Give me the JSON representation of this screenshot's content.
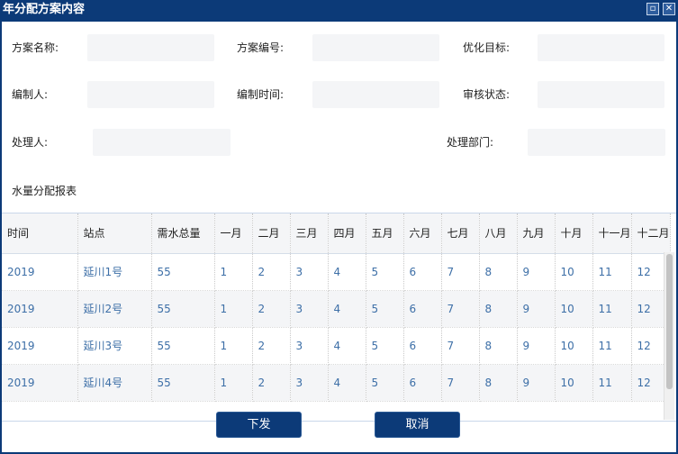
{
  "window": {
    "title": "年分配方案内容",
    "maximize_symbol": "▫",
    "close_symbol": "✕"
  },
  "form": {
    "plan_name": {
      "label": "方案名称:",
      "value": ""
    },
    "plan_code": {
      "label": "方案编号:",
      "value": ""
    },
    "goal": {
      "label": "优化目标:",
      "value": ""
    },
    "author": {
      "label": "编制人:",
      "value": ""
    },
    "compile_time": {
      "label": "编制时间:",
      "value": ""
    },
    "review_status": {
      "label": "审核状态:",
      "value": ""
    },
    "handler": {
      "label": "处理人:",
      "value": ""
    },
    "department": {
      "label": "处理部门:",
      "value": ""
    }
  },
  "section_title": "水量分配报表",
  "table": {
    "headers": [
      "时间",
      "站点",
      "需水总量",
      "一月",
      "二月",
      "三月",
      "四月",
      "五月",
      "六月",
      "七月",
      "八月",
      "九月",
      "十月",
      "十一月",
      "十二月"
    ],
    "rows": [
      [
        "2019",
        "延川1号",
        "55",
        "1",
        "2",
        "3",
        "4",
        "5",
        "6",
        "7",
        "8",
        "9",
        "10",
        "11",
        "12"
      ],
      [
        "2019",
        "延川2号",
        "55",
        "1",
        "2",
        "3",
        "4",
        "5",
        "6",
        "7",
        "8",
        "9",
        "10",
        "11",
        "12"
      ],
      [
        "2019",
        "延川3号",
        "55",
        "1",
        "2",
        "3",
        "4",
        "5",
        "6",
        "7",
        "8",
        "9",
        "10",
        "11",
        "12"
      ],
      [
        "2019",
        "延川4号",
        "55",
        "1",
        "2",
        "3",
        "4",
        "5",
        "6",
        "7",
        "8",
        "9",
        "10",
        "11",
        "12"
      ]
    ]
  },
  "buttons": {
    "issue": "下发",
    "cancel": "取消"
  },
  "colors": {
    "title_bar": "#0c3a78",
    "cell_text": "#3d6fa7",
    "field_bg": "#f4f5f7"
  }
}
